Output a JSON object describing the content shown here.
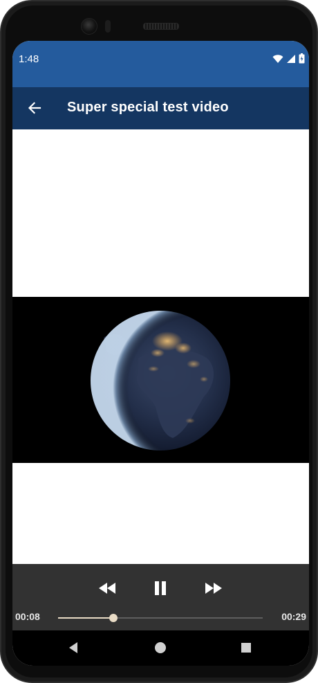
{
  "status_bar": {
    "time": "1:48",
    "icons": [
      "wifi-icon",
      "signal-icon",
      "battery-icon"
    ],
    "color": "#245b9d"
  },
  "app_bar": {
    "back_icon": "arrow-left-icon",
    "title": "Super special test video",
    "color": "#143661"
  },
  "video": {
    "content": "earth-at-night"
  },
  "player_controls": {
    "rewind_icon": "rewind-icon",
    "pause_icon": "pause-icon",
    "forward_icon": "fast-forward-icon",
    "current_time": "00:08",
    "duration": "00:29",
    "progress": 0.27,
    "accent": "#e9dcc6"
  },
  "nav_bar": {
    "back_icon": "nav-back-icon",
    "home_icon": "nav-home-icon",
    "recents_icon": "nav-recents-icon"
  }
}
